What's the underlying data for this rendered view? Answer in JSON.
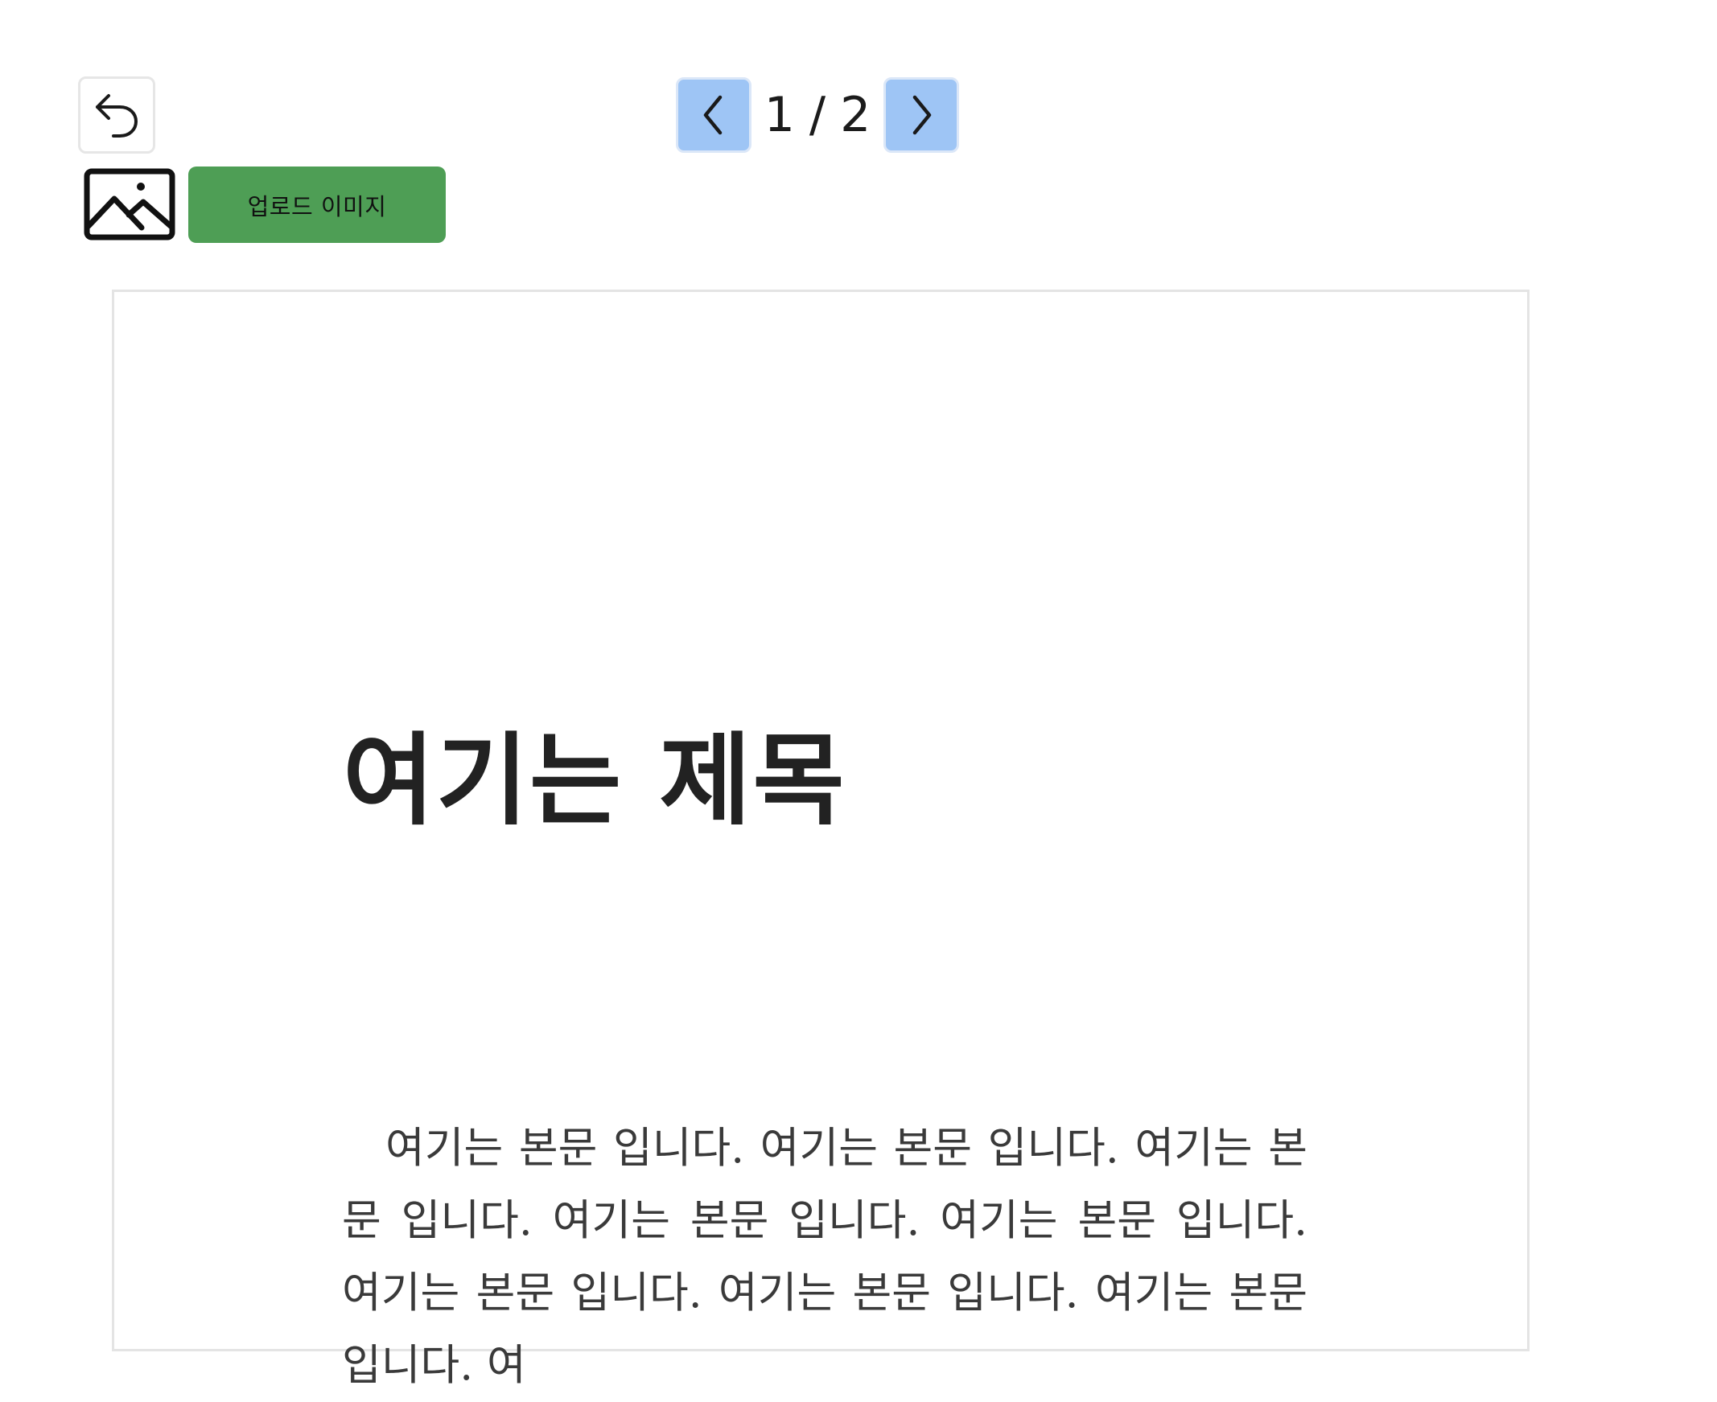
{
  "toolbar": {
    "undo_icon": "undo-arrow-icon",
    "image_icon": "image-icon",
    "upload_label": "업로드 이미지",
    "upload_color": "#4e9e55"
  },
  "pagination": {
    "current": "1",
    "separator": "/",
    "total": "2",
    "prev_icon": "chevron-left-icon",
    "next_icon": "chevron-right-icon",
    "button_color": "#9ec5f5"
  },
  "document": {
    "title": "여기는 제목",
    "body": "여기는 본문 입니다. 여기는 본문 입니다. 여기는 본문 입니다. 여기는 본문 입니다. 여기는 본문 입니다. 여기는 본문 입니다. 여기는 본문 입니다. 여기는 본문 입니다. 여"
  }
}
